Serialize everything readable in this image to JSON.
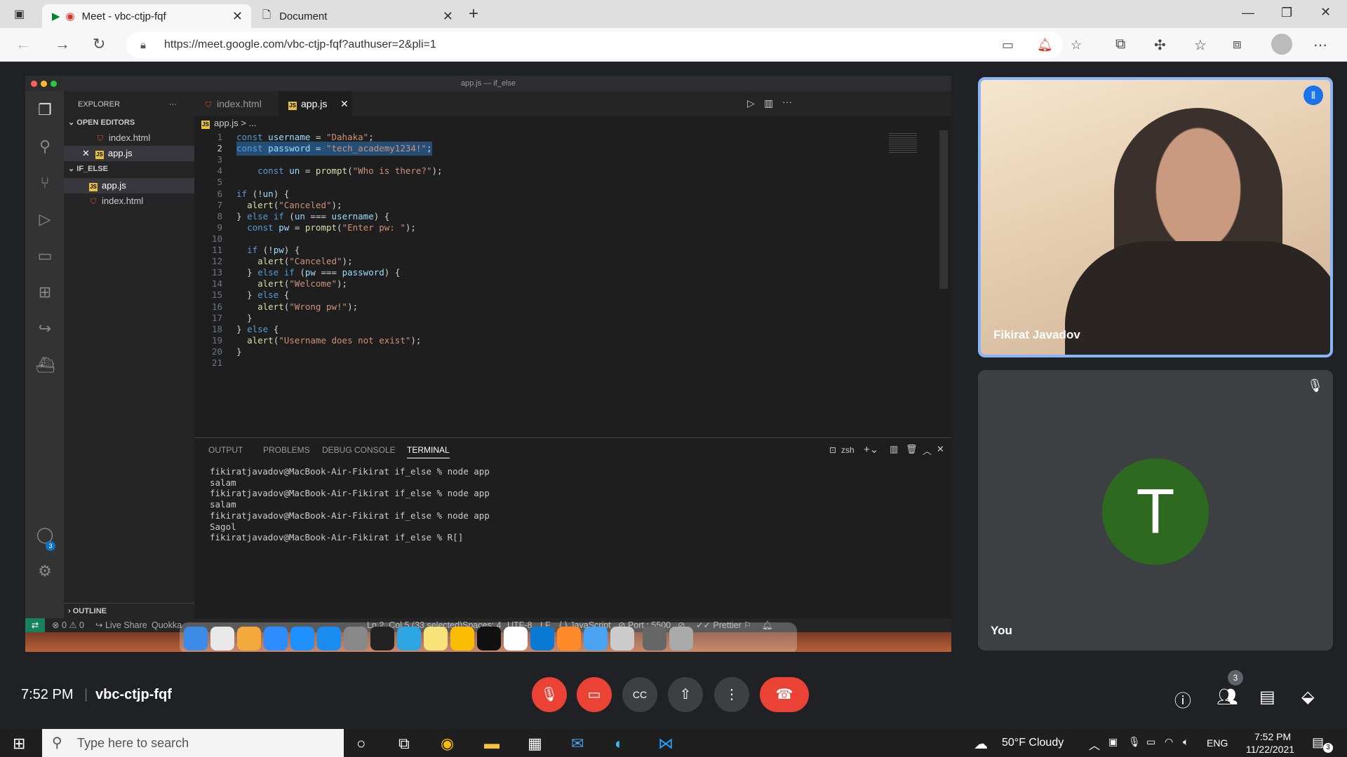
{
  "browser": {
    "tabs": [
      {
        "title": "Meet - vbc-ctjp-fqf",
        "active": true
      },
      {
        "title": "Document",
        "active": false
      }
    ],
    "url": "https://meet.google.com/vbc-ctjp-fqf?authuser=2&pli=1"
  },
  "vscode": {
    "window_title": "app.js — if_else",
    "explorer_title": "EXPLORER",
    "open_editors_label": "OPEN EDITORS",
    "open_editors": [
      "index.html",
      "app.js"
    ],
    "folder_label": "IF_ELSE",
    "folder_files": [
      "app.js",
      "index.html"
    ],
    "outline_label": "OUTLINE",
    "editor_tabs": [
      "index.html",
      "app.js"
    ],
    "breadcrumb": "app.js > ...",
    "code_lines": [
      "const username = \"Dahaka\";",
      "const password = \"tech_academy1234!\";",
      "",
      "    const un = prompt(\"Who is there?\");",
      "",
      "if (!un) {",
      "  alert(\"Canceled\");",
      "} else if (un === username) {",
      "  const pw = prompt(\"Enter pw: \");",
      "",
      "  if (!pw) {",
      "    alert(\"Canceled\");",
      "  } else if (pw === password) {",
      "    alert(\"Welcome\");",
      "  } else {",
      "    alert(\"Wrong pw!\");",
      "  }",
      "} else {",
      "  alert(\"Username does not exist\");",
      "}",
      ""
    ],
    "panel_tabs": [
      "OUTPUT",
      "PROBLEMS",
      "DEBUG CONSOLE",
      "TERMINAL"
    ],
    "terminal_shell": "zsh",
    "terminal_lines": [
      "fikiratjavadov@MacBook-Air-Fikirat if_else % node app",
      "salam",
      "fikiratjavadov@MacBook-Air-Fikirat if_else % node app",
      "salam",
      "fikiratjavadov@MacBook-Air-Fikirat if_else % node app",
      "Sagol",
      "fikiratjavadov@MacBook-Air-Fikirat if_else % R[]"
    ],
    "status": {
      "problems": "⊗ 0 ⚠ 0",
      "live_share": "Live Share",
      "quokka": "Quokka",
      "position": "Ln 2, Col 5 (33 selected)",
      "spaces": "Spaces: 4",
      "encoding": "UTF-8",
      "eol": "LF",
      "language": "{ } JavaScript",
      "port": "⊘ Port : 5500",
      "prettier": "✓✓ Prettier"
    },
    "account_badge": "3"
  },
  "meet": {
    "participants": [
      {
        "name": "Fikirat Javadov",
        "speaking": true
      },
      {
        "name": "You",
        "initial": "T",
        "muted": true
      }
    ],
    "time": "7:52 PM",
    "meeting_code": "vbc-ctjp-fqf",
    "people_count": "3"
  },
  "taskbar": {
    "search_placeholder": "Type here to search",
    "weather": "50°F  Cloudy",
    "language": "ENG",
    "time": "7:52 PM",
    "date": "11/22/2021",
    "notifications": "3"
  }
}
